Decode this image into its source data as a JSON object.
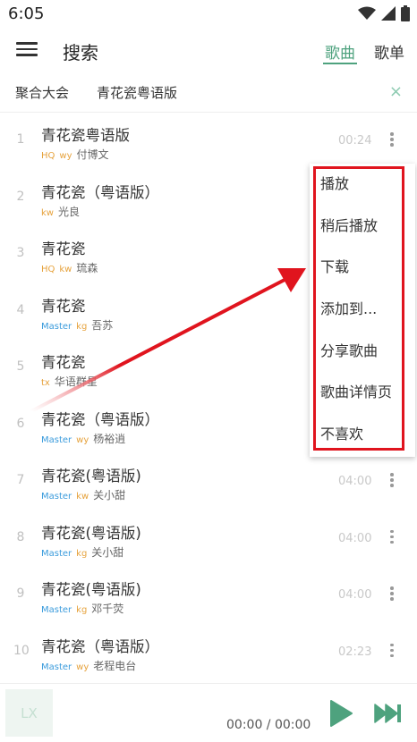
{
  "status_bar": {
    "time": "6:05"
  },
  "header": {
    "title": "搜索",
    "tabs": [
      {
        "label": "歌曲"
      },
      {
        "label": "歌单"
      }
    ]
  },
  "search": {
    "source": "聚合大会",
    "term": "青花瓷粤语版",
    "clear": "×"
  },
  "songs": [
    {
      "index": "1",
      "title": "青花瓷粤语版",
      "quality": "HQ",
      "source": "wy",
      "artist": "付博文",
      "duration": "00:24"
    },
    {
      "index": "2",
      "title": "青花瓷（粤语版）",
      "quality": "",
      "source": "kw",
      "artist": "光良",
      "duration": ""
    },
    {
      "index": "3",
      "title": "青花瓷",
      "quality": "HQ",
      "source": "kw",
      "artist": "琉森",
      "duration": ""
    },
    {
      "index": "4",
      "title": "青花瓷",
      "quality": "Master",
      "source": "kg",
      "artist": "吾苏",
      "duration": ""
    },
    {
      "index": "5",
      "title": "青花瓷",
      "quality": "",
      "source": "tx",
      "artist": "华语群星",
      "duration": ""
    },
    {
      "index": "6",
      "title": "青花瓷（粤语版）",
      "quality": "Master",
      "source": "wy",
      "artist": "杨裕逍",
      "duration": ""
    },
    {
      "index": "7",
      "title": "青花瓷(粤语版)",
      "quality": "Master",
      "source": "kw",
      "artist": "关小甜",
      "duration": "04:00"
    },
    {
      "index": "8",
      "title": "青花瓷(粤语版)",
      "quality": "Master",
      "source": "kg",
      "artist": "关小甜",
      "duration": "04:00"
    },
    {
      "index": "9",
      "title": "青花瓷(粤语版)",
      "quality": "Master",
      "source": "kg",
      "artist": "邓千荧",
      "duration": "04:00"
    },
    {
      "index": "10",
      "title": "青花瓷（粤语版）",
      "quality": "Master",
      "source": "wy",
      "artist": "老程电台",
      "duration": "02:23"
    }
  ],
  "context_menu": {
    "items": [
      {
        "label": "播放"
      },
      {
        "label": "稍后播放"
      },
      {
        "label": "下载"
      },
      {
        "label": "添加到..."
      },
      {
        "label": "分享歌曲"
      },
      {
        "label": "歌曲详情页"
      },
      {
        "label": "不喜欢"
      }
    ]
  },
  "player": {
    "cover_text": "LX",
    "time": "00:00 / 00:00"
  },
  "colors": {
    "accent": "#4ea27e",
    "tag_hq": "#e6a23c",
    "tag_master": "#3a9bdc",
    "tag_source": "#e6a23c",
    "annotation": "#e0141e"
  },
  "icons": [
    "wifi-icon",
    "signal-icon",
    "battery-icon",
    "menu-icon",
    "close-icon",
    "more-vert-icon",
    "play-icon",
    "skip-next-icon"
  ]
}
